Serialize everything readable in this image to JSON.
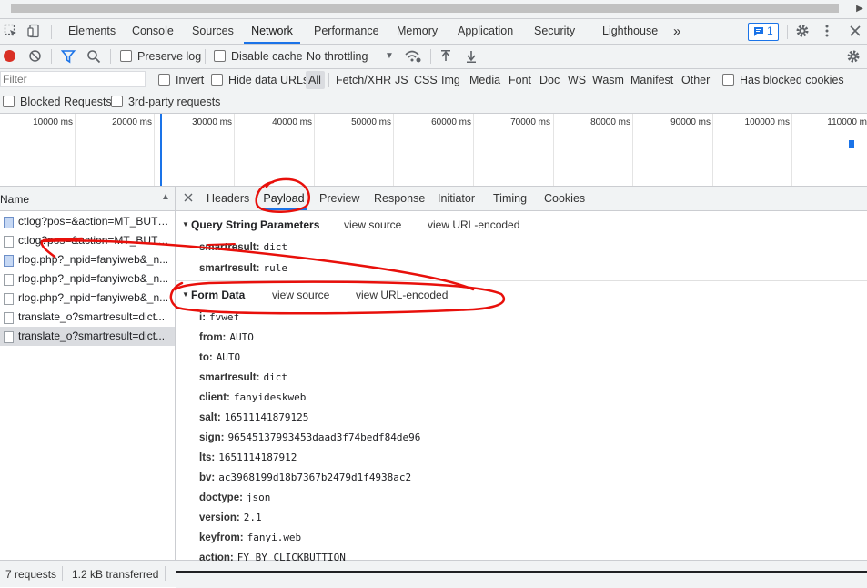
{
  "tabs": [
    "Elements",
    "Console",
    "Sources",
    "Network",
    "Performance",
    "Memory",
    "Application",
    "Security",
    "Lighthouse"
  ],
  "more_tabs": "»",
  "issues_count": "1",
  "toolbar": {
    "preserve_log": "Preserve log",
    "disable_cache": "Disable cache",
    "throttling": "No throttling"
  },
  "filter": {
    "placeholder": "Filter",
    "invert": "Invert",
    "hide_data_urls": "Hide data URLs",
    "types": [
      "All",
      "Fetch/XHR",
      "JS",
      "CSS",
      "Img",
      "Media",
      "Font",
      "Doc",
      "WS",
      "Wasm",
      "Manifest",
      "Other"
    ],
    "has_blocked_cookies": "Has blocked cookies",
    "blocked_requests": "Blocked Requests",
    "third_party": "3rd-party requests"
  },
  "timeline_ticks": [
    "10000 ms",
    "20000 ms",
    "30000 ms",
    "40000 ms",
    "50000 ms",
    "60000 ms",
    "70000 ms",
    "80000 ms",
    "90000 ms",
    "100000 ms",
    "110000 m"
  ],
  "requests_header": "Name",
  "requests": [
    {
      "name": "ctlog?pos=&action=MT_BUTTON...",
      "kind": "img"
    },
    {
      "name": "ctlog?pos=&action=MT_BUTTON...",
      "kind": "doc"
    },
    {
      "name": "rlog.php?_npid=fanyiweb&_n...",
      "kind": "img"
    },
    {
      "name": "rlog.php?_npid=fanyiweb&_n...",
      "kind": "doc"
    },
    {
      "name": "rlog.php?_npid=fanyiweb&_n...",
      "kind": "doc"
    },
    {
      "name": "translate_o?smartresult=dict...",
      "kind": "doc"
    },
    {
      "name": "translate_o?smartresult=dict...",
      "kind": "doc"
    }
  ],
  "status": {
    "requests": "7 requests",
    "transferred": "1.2 kB transferred"
  },
  "detail_tabs": [
    "Headers",
    "Payload",
    "Preview",
    "Response",
    "Initiator",
    "Timing",
    "Cookies"
  ],
  "query_section": {
    "title": "Query String Parameters",
    "view_source": "view source",
    "view_url_encoded": "view URL-encoded",
    "params": [
      {
        "key": "smartresult:",
        "value": "dict"
      },
      {
        "key": "smartresult:",
        "value": "rule"
      }
    ]
  },
  "form_section": {
    "title": "Form Data",
    "view_source": "view source",
    "view_url_encoded": "view URL-encoded",
    "params": [
      {
        "key": "i:",
        "value": "fvwef"
      },
      {
        "key": "from:",
        "value": "AUTO"
      },
      {
        "key": "to:",
        "value": "AUTO"
      },
      {
        "key": "smartresult:",
        "value": "dict"
      },
      {
        "key": "client:",
        "value": "fanyideskweb"
      },
      {
        "key": "salt:",
        "value": "16511141879125"
      },
      {
        "key": "sign:",
        "value": "96545137993453daad3f74bedf84de96"
      },
      {
        "key": "lts:",
        "value": "1651114187912"
      },
      {
        "key": "bv:",
        "value": "ac3968199d18b7367b2479d1f4938ac2"
      },
      {
        "key": "doctype:",
        "value": "json"
      },
      {
        "key": "version:",
        "value": "2.1"
      },
      {
        "key": "keyfrom:",
        "value": "fanyi.web"
      },
      {
        "key": "action:",
        "value": "FY_BY_CLICKBUTTION"
      }
    ]
  }
}
